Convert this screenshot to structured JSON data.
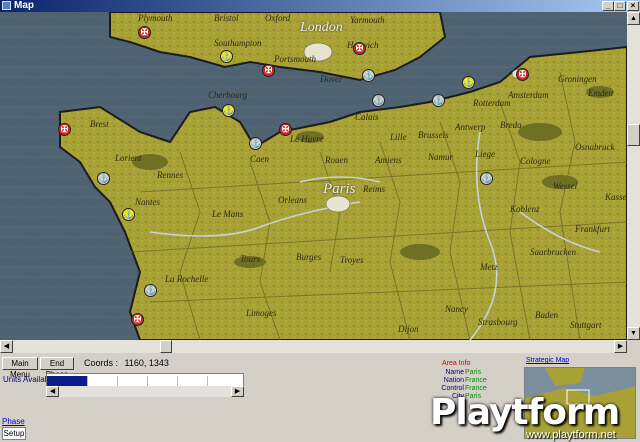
{
  "window": {
    "title": "Map"
  },
  "map": {
    "labels": {
      "plymouth": "Plymouth",
      "bristol": "Bristol",
      "oxford": "Oxford",
      "london": "London",
      "yarmouth": "Yarmouth",
      "southampton": "Southampton",
      "harwich": "Harwich",
      "portsmouth": "Portsmouth",
      "dover": "Dover",
      "groningen": "Groningen",
      "amsterdam": "Amsterdam",
      "emden": "Emden",
      "cherbourg": "Cherbourg",
      "calais": "Calais",
      "rotterdam": "Rotterdam",
      "brest": "Brest",
      "lehavre": "Le Havre",
      "lille": "Lille",
      "brussels": "Brussels",
      "antwerp": "Antwerp",
      "breda": "Breda",
      "osnabruck": "Osnabruck",
      "caen": "Caen",
      "rouen": "Rouen",
      "amiens": "Amiens",
      "namur": "Namur",
      "liege": "Liege",
      "cologne": "Cologne",
      "lorient": "Lorient",
      "rennes": "Rennes",
      "paris": "Paris",
      "reims": "Reims",
      "wessel": "Wessel",
      "kassel": "Kasse",
      "nantes": "Nantes",
      "orleans": "Orleans",
      "lemans": "Le Mans",
      "koblenz": "Koblenz",
      "frankfurt": "Frankfurt",
      "troyes": "Troyes",
      "tours": "Tours",
      "burges": "Burges",
      "metz": "Metz",
      "saarbrucken": "Saarbrucken",
      "larochelle": "La Rochelle",
      "limoges": "Limoges",
      "nancy": "Nancy",
      "strasbourg": "Strasbourg",
      "baden": "Baden",
      "stuttgart": "Stuttgart",
      "dijon": "Dijon"
    },
    "marker_icons": {
      "port": "anchor-icon",
      "red": "fleet-icon",
      "grey": "port-icon"
    }
  },
  "toolbar": {
    "main_menu": "Main Menu",
    "end_phase": "End Phase"
  },
  "coords": {
    "label": "Coords :",
    "value": "1160, 1343"
  },
  "units": {
    "label": "Units Available"
  },
  "phase": {
    "label": "Phase",
    "setup": "Setup"
  },
  "area_info": {
    "title": "Area Info",
    "rows": [
      {
        "key": "Name",
        "value": "Paris"
      },
      {
        "key": "Nation",
        "value": "France"
      },
      {
        "key": "Control",
        "value": "France"
      },
      {
        "key": "City",
        "value": "Paris"
      }
    ]
  },
  "strategic_map": {
    "label": "Strategic Map"
  },
  "watermark": {
    "logo": "Playtform",
    "url": "www.playtform.net"
  },
  "colors": {
    "sea": "#4e6272",
    "land": "#a8a236",
    "title_bar": "#0a246a",
    "selection": "#0b1d8a"
  }
}
